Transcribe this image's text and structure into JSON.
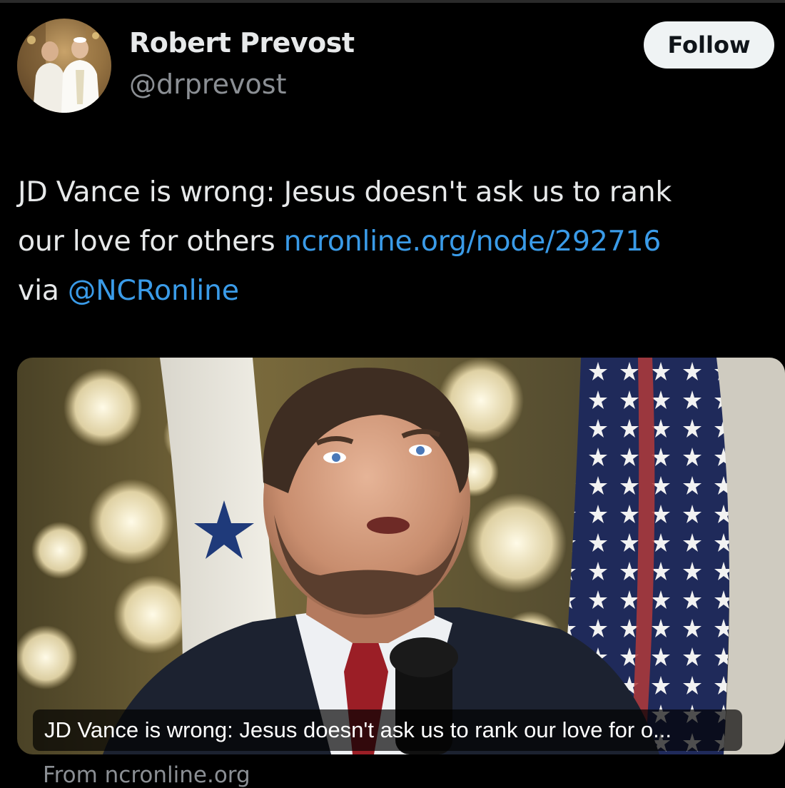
{
  "author": {
    "name": "Robert Prevost",
    "handle": "@drprevost",
    "avatar_icon": "avatar-photo"
  },
  "follow_button": {
    "label": "Follow"
  },
  "tweet": {
    "line1": "JD Vance is wrong: Jesus doesn't ask us to rank",
    "line2_text": "our love for others ",
    "link": "ncronline.org/node/292716",
    "line3_text": "via ",
    "mention": "@NCRonline"
  },
  "card": {
    "caption": "JD Vance is wrong: Jesus doesn't ask us to rank our love for o...",
    "source": "From ncronline.org"
  },
  "colors": {
    "background": "#000000",
    "text": "#e7e9ea",
    "secondary_text": "#8b8f94",
    "link": "#3a9be8",
    "follow_bg": "#eff3f4"
  }
}
